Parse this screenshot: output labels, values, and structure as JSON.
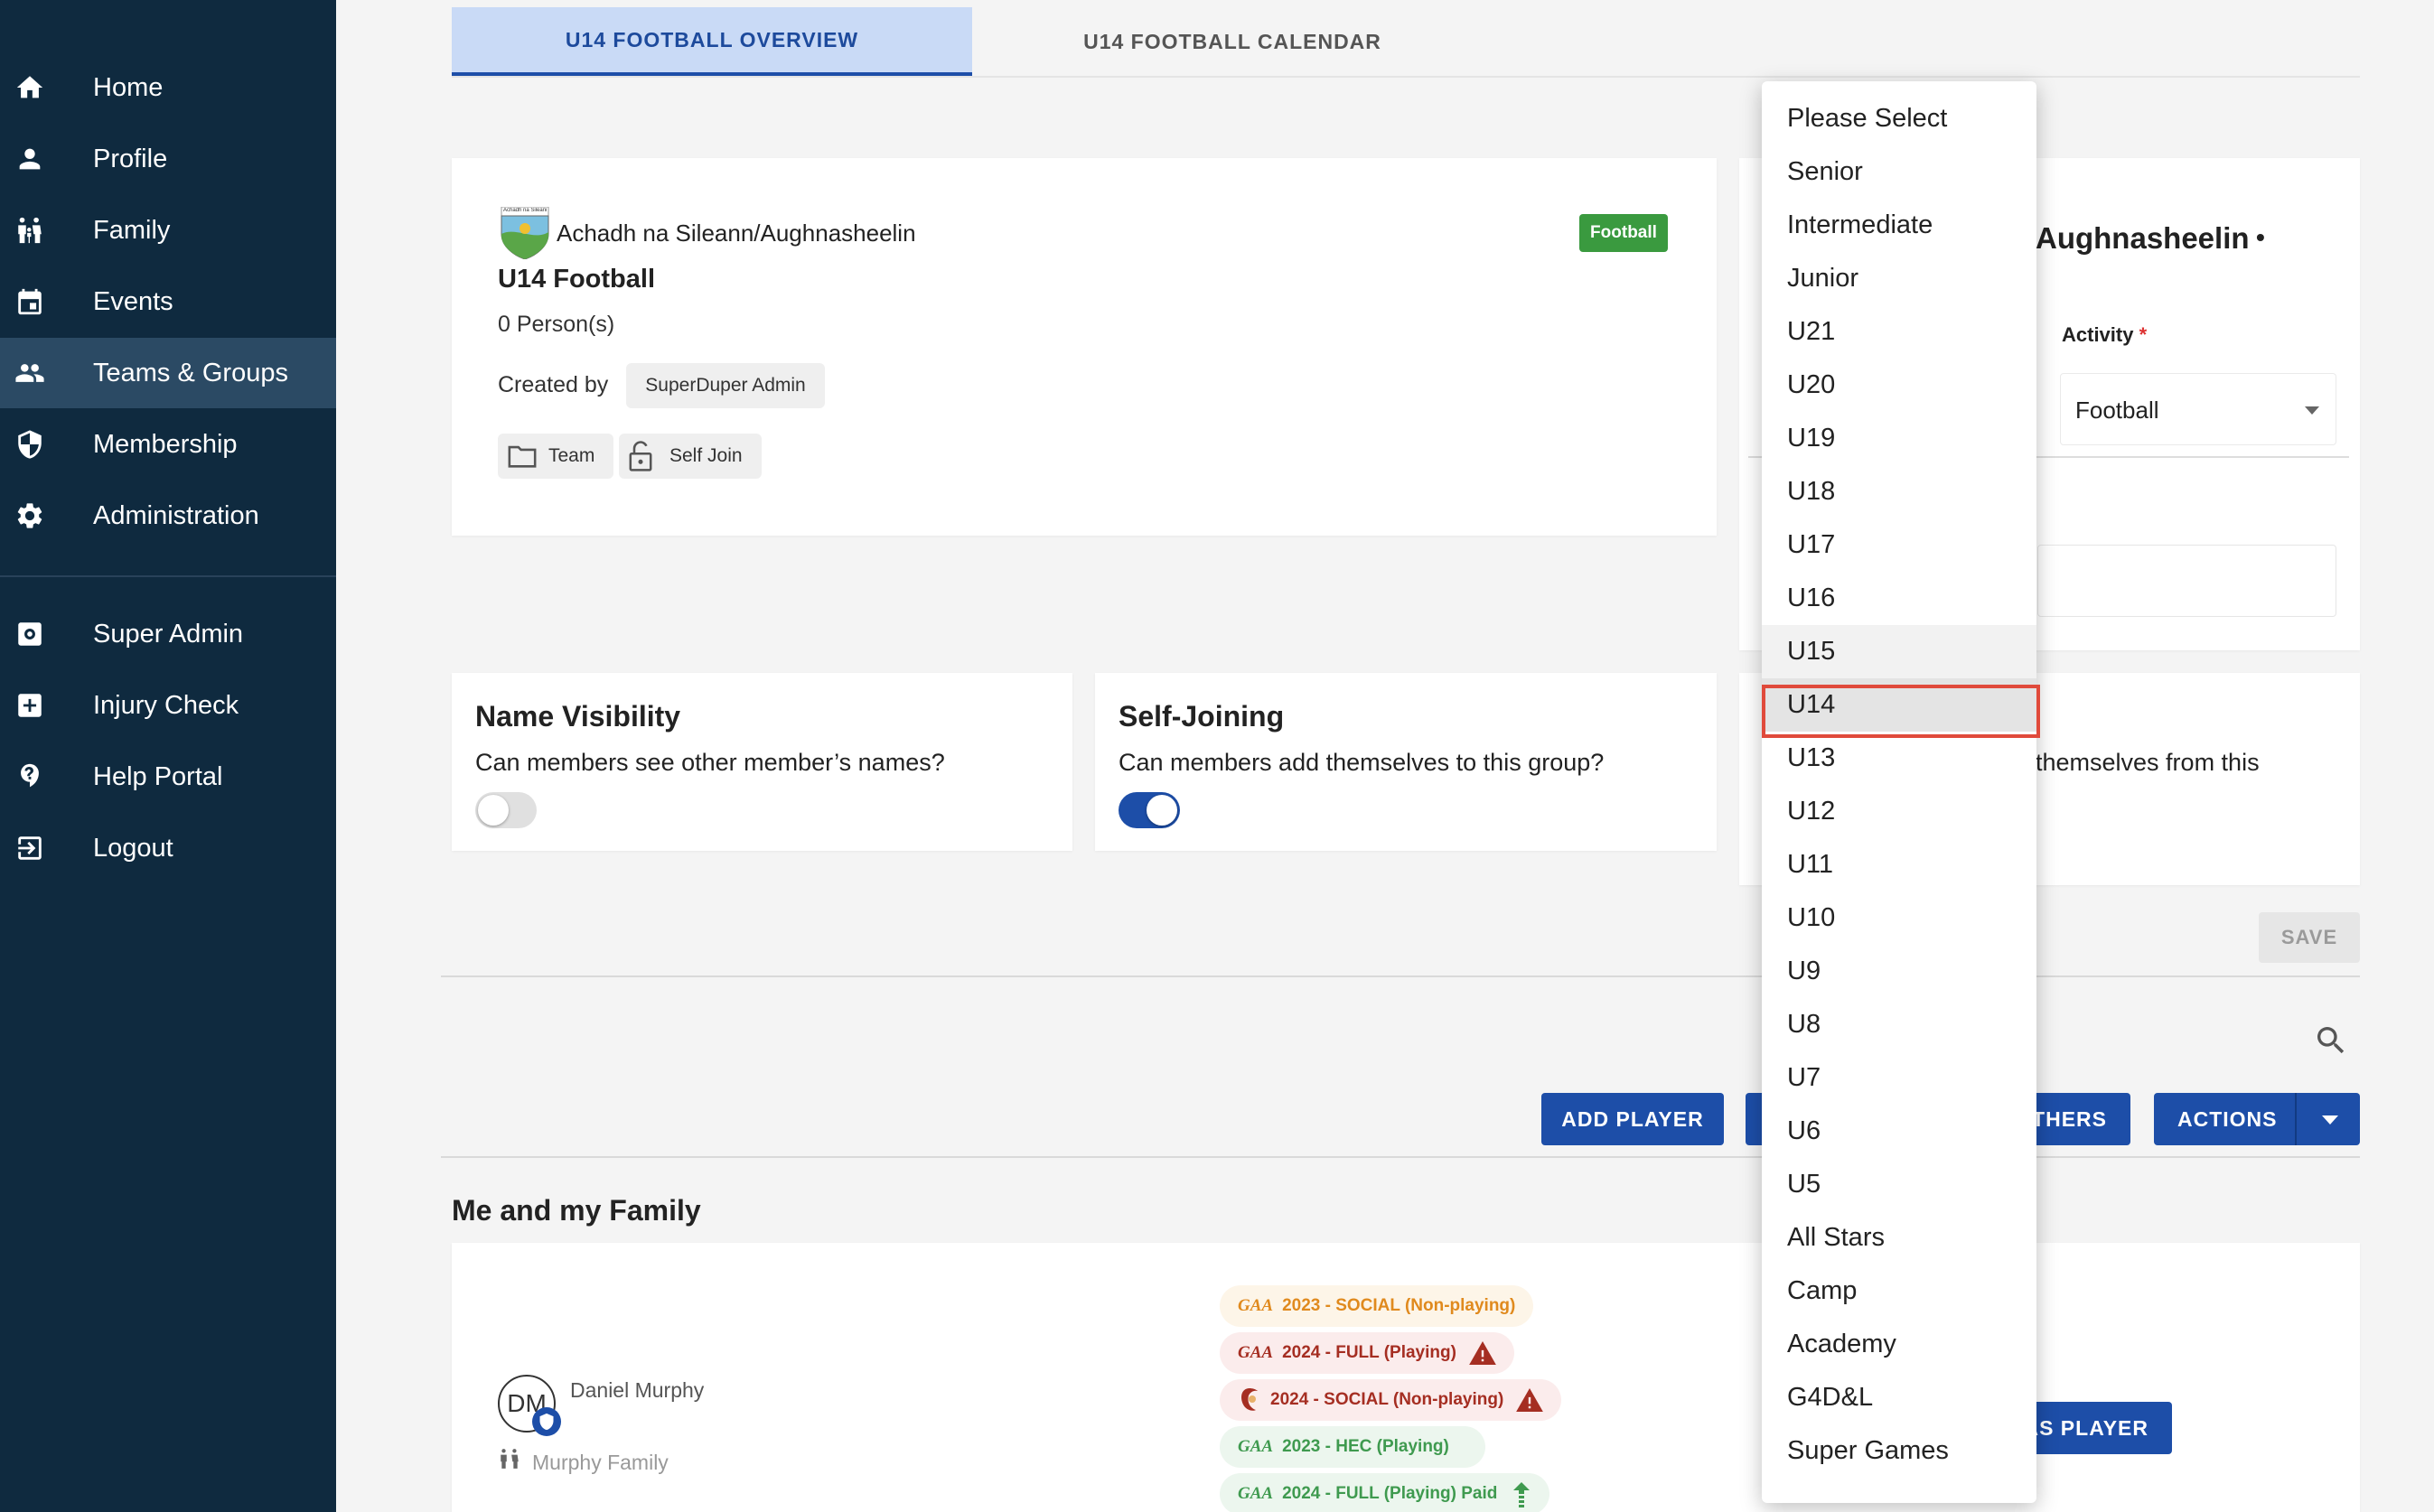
{
  "sidebar": {
    "items": [
      {
        "label": "Home",
        "icon": "home-icon"
      },
      {
        "label": "Profile",
        "icon": "person-icon"
      },
      {
        "label": "Family",
        "icon": "family-icon"
      },
      {
        "label": "Events",
        "icon": "calendar-icon"
      },
      {
        "label": "Teams & Groups",
        "icon": "groups-icon"
      },
      {
        "label": "Membership",
        "icon": "shield-icon"
      },
      {
        "label": "Administration",
        "icon": "gear-icon"
      }
    ],
    "extra_items": [
      {
        "label": "Super Admin",
        "icon": "admin-settings-icon"
      },
      {
        "label": "Injury Check",
        "icon": "medical-cross-icon"
      },
      {
        "label": "Help Portal",
        "icon": "help-icon"
      },
      {
        "label": "Logout",
        "icon": "logout-icon"
      }
    ]
  },
  "tabs": [
    {
      "label": "U14 FOOTBALL OVERVIEW"
    },
    {
      "label": "U14 FOOTBALL CALENDAR"
    }
  ],
  "group_card": {
    "club_name": "Achadh na Sileann/Aughnasheelin",
    "crest_text": "Achadh na Sileann",
    "group_name": "U14 Football",
    "person_count": "0 Person(s)",
    "created_by_label": "Created by",
    "created_by_name": "SuperDuper Admin",
    "type_chip": "Team",
    "join_chip": "Self Join",
    "activity_badge": "Football"
  },
  "edit_panel": {
    "club_partial": "Aughnasheelin",
    "activity_label": "Activity",
    "activity_required": "*",
    "activity_value": "Football",
    "save_label": "SAVE"
  },
  "name_visibility": {
    "title": "Name Visibility",
    "description": "Can members see other member’s names?"
  },
  "self_joining": {
    "title": "Self-Joining",
    "description": "Can members add themselves to this group?"
  },
  "self_leave": {
    "partial_text": "themselves from this"
  },
  "actions_bar": {
    "add_player": "ADD PLAYER",
    "others_partial": "THERS",
    "actions": "ACTIONS"
  },
  "family_section": {
    "title": "Me and my Family",
    "member": {
      "initials": "DM",
      "name": "Daniel Murphy",
      "family": "Murphy Family"
    },
    "memberships": [
      {
        "logo": "GAA",
        "text": "2023 - SOCIAL (Non-playing)",
        "color": "#e08a1e"
      },
      {
        "logo": "GAA",
        "text": "2024 - FULL (Playing)",
        "color": "#a52e22"
      },
      {
        "logo": "GAA",
        "text": "2024 - SOCIAL (Non-playing)",
        "color": "#a52e22"
      },
      {
        "logo": "GAA",
        "text": "2023 - HEC (Playing)",
        "color": "#3f9a4f"
      },
      {
        "logo": "GAA",
        "text": "2024 - FULL (Playing) Paid",
        "color": "#3f9a4f"
      }
    ],
    "as_player_partial": "AS PLAYER"
  },
  "dropdown": {
    "options": [
      "Please Select",
      "Senior",
      "Intermediate",
      "Junior",
      "U21",
      "U20",
      "U19",
      "U18",
      "U17",
      "U16",
      "U15",
      "U14",
      "U13",
      "U12",
      "U11",
      "U10",
      "U9",
      "U8",
      "U7",
      "U6",
      "U5",
      "All Stars",
      "Camp",
      "Academy",
      "G4D&L",
      "Super Games"
    ],
    "selected": "U14"
  },
  "colors": {
    "sidebar_bg": "#0f2a3f",
    "sidebar_active": "#2b4a64",
    "primary": "#1d4ea8",
    "tab_active_bg": "#c9daf6",
    "football_badge": "#3a9a3f",
    "highlight_border": "#e04a3b"
  }
}
